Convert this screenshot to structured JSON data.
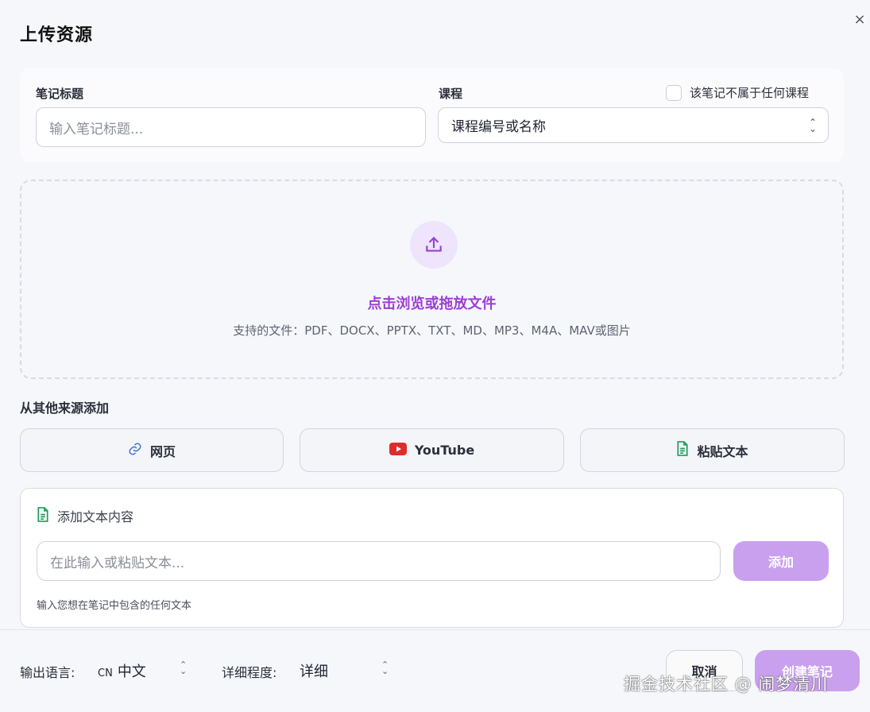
{
  "dialog": {
    "title": "上传资源",
    "close_label": "×"
  },
  "note_title": {
    "label": "笔记标题",
    "placeholder": "输入笔记标题..."
  },
  "course": {
    "label": "课程",
    "select_value": "课程编号或名称",
    "no_course_label": "该笔记不属于任何课程"
  },
  "dropzone": {
    "icon": "upload-icon",
    "title": "点击浏览或拖放文件",
    "subtitle": "支持的文件：PDF、DOCX、PPTX、TXT、MD、MP3、M4A、MAV或图片"
  },
  "sources": {
    "title": "从其他来源添加",
    "buttons": [
      {
        "label": "网页",
        "icon": "link-icon",
        "color": "#3b6fd6"
      },
      {
        "label": "YouTube",
        "icon": "youtube-icon",
        "color": "#e02b2b"
      },
      {
        "label": "粘贴文本",
        "icon": "document-icon",
        "color": "#1e9e5a"
      }
    ]
  },
  "text_panel": {
    "title": "添加文本内容",
    "placeholder": "在此输入或粘贴文本...",
    "add_label": "添加",
    "hint": "输入您想在笔记中包含的任何文本"
  },
  "footer": {
    "language_label": "输出语言:",
    "language_code": "CN",
    "language_value": "中文",
    "detail_label": "详细程度:",
    "detail_value": "详细",
    "cancel_label": "取消",
    "create_label": "创建笔记"
  },
  "watermark": "掘金技术社区 @ 闹梦清川",
  "colors": {
    "accent": "#9b3fd4",
    "accent_button": "#c9a0ee"
  }
}
